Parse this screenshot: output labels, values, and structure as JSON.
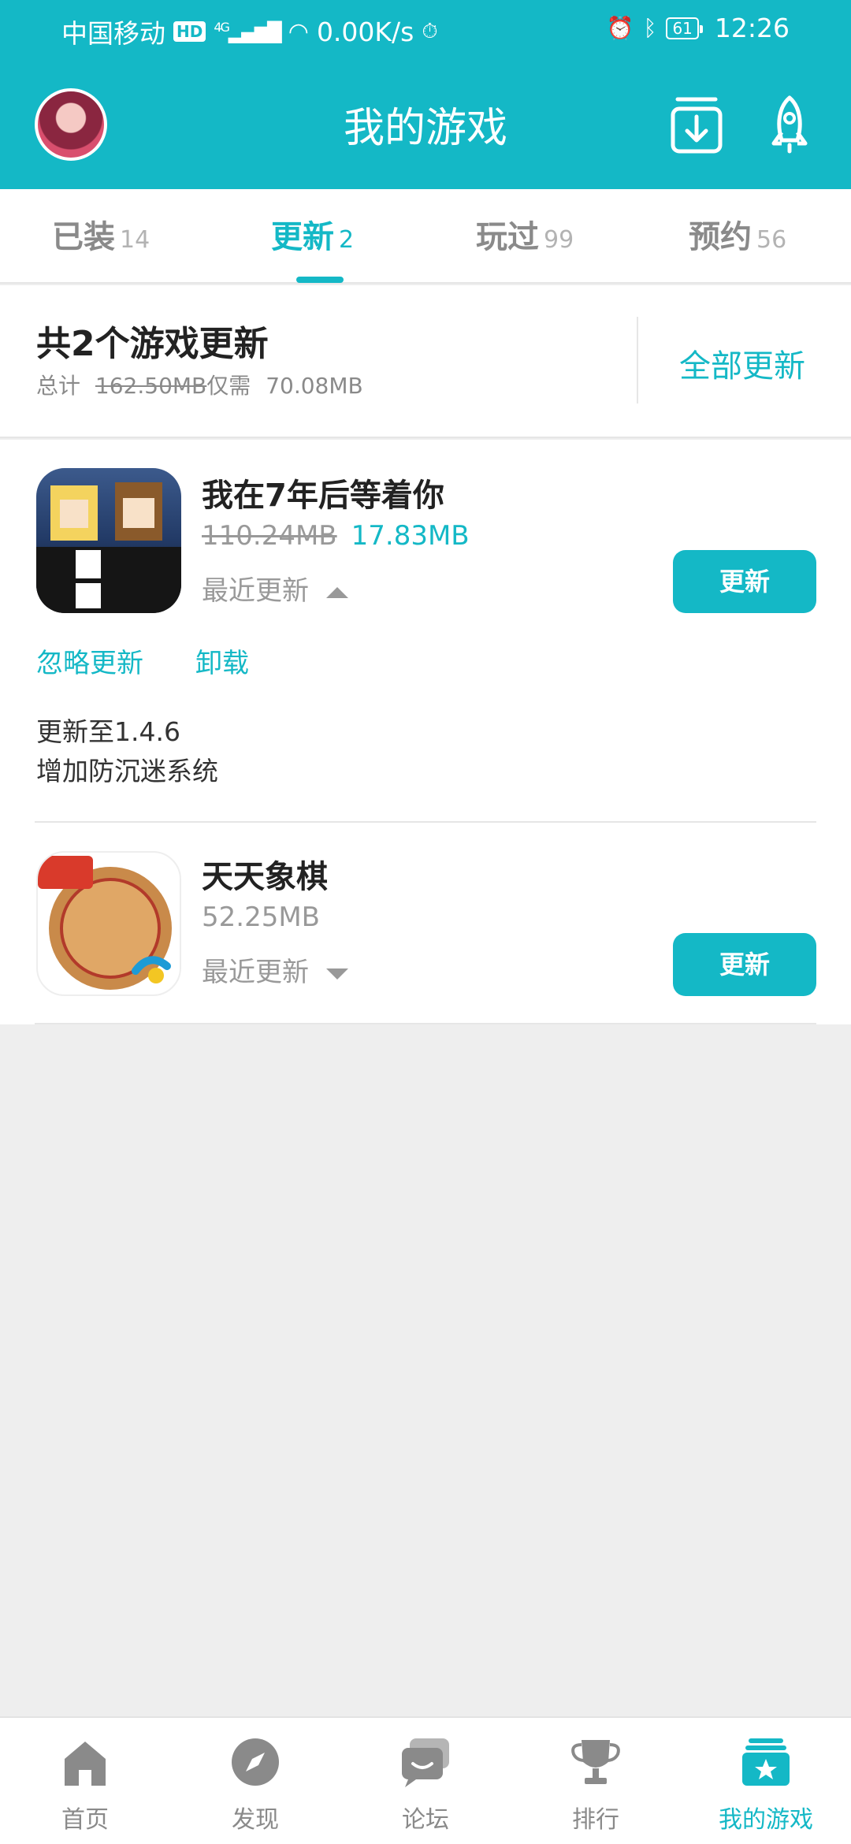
{
  "status_bar": {
    "carrier": "中国移动",
    "hd": "HD",
    "signal": "4G",
    "speed": "0.00K/s",
    "battery": "61",
    "time": "12:26"
  },
  "header": {
    "title": "我的游戏",
    "avatar_icon": "avatar",
    "download_icon": "download-icon",
    "rocket_icon": "rocket-icon",
    "accent_color": "#14b8c6"
  },
  "tabs": [
    {
      "label": "已装",
      "count": "14"
    },
    {
      "label": "更新",
      "count": "2",
      "active": true
    },
    {
      "label": "玩过",
      "count": "99"
    },
    {
      "label": "预约",
      "count": "56"
    }
  ],
  "summary": {
    "title": "共2个游戏更新",
    "total_label": "总计",
    "total_size": "162.50MB",
    "need_label": "仅需",
    "need_size": "70.08MB",
    "update_all": "全部更新"
  },
  "games": [
    {
      "name": "我在7年后等着你",
      "old_size": "110.24MB",
      "new_size": "17.83MB",
      "recent_label": "最近更新",
      "expanded": true,
      "button": "更新",
      "ignore": "忽略更新",
      "uninstall": "卸载",
      "changelog_version": "更新至1.4.6",
      "changelog_text": "增加防沉迷系统"
    },
    {
      "name": "天天象棋",
      "size": "52.25MB",
      "recent_label": "最近更新",
      "expanded": false,
      "button": "更新"
    }
  ],
  "bottom_nav": [
    {
      "label": "首页",
      "icon": "home-icon"
    },
    {
      "label": "发现",
      "icon": "compass-icon"
    },
    {
      "label": "论坛",
      "icon": "chat-icon"
    },
    {
      "label": "排行",
      "icon": "trophy-icon"
    },
    {
      "label": "我的游戏",
      "icon": "my-games-icon",
      "active": true
    }
  ]
}
